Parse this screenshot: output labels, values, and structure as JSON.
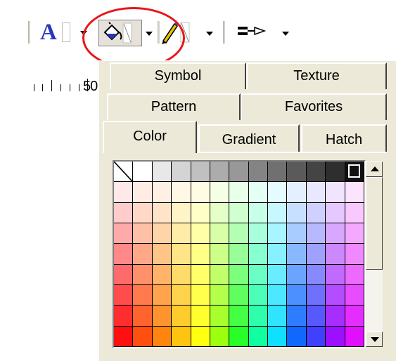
{
  "toolbar": {
    "font_icon_glyph": "A",
    "ruler_value": "50"
  },
  "tabs": {
    "row1": [
      {
        "label": "Symbol"
      },
      {
        "label": "Texture"
      }
    ],
    "row2": [
      {
        "label": "Pattern"
      },
      {
        "label": "Favorites"
      }
    ],
    "row3": [
      {
        "label": "Color"
      },
      {
        "label": "Gradient"
      },
      {
        "label": "Hatch"
      }
    ],
    "active": "Color"
  },
  "palette": {
    "rows": [
      [
        "none",
        "#ffffff",
        "#e8e8e8",
        "#d4d4d4",
        "#c0c0c0",
        "#acacac",
        "#989898",
        "#848484",
        "#707070",
        "#5a5a5a",
        "#444444",
        "#2e2e2e",
        "selected-black"
      ],
      [
        "#ffe8e8",
        "#ffece4",
        "#fff0e4",
        "#fff8e4",
        "#fffce4",
        "#f4ffe4",
        "#e8ffe8",
        "#e4fff4",
        "#e4fcff",
        "#e4f0ff",
        "#e8e8ff",
        "#f0e4ff",
        "#fce4ff"
      ],
      [
        "#ffcccc",
        "#ffd8c8",
        "#ffe4c8",
        "#fff4c8",
        "#ffffc8",
        "#e4ffc8",
        "#d0ffd0",
        "#c8ffe8",
        "#c8f8ff",
        "#c8e0ff",
        "#d0d0ff",
        "#e4c8ff",
        "#f8c8ff"
      ],
      [
        "#ffaaaa",
        "#ffc0a8",
        "#ffd4a8",
        "#ffeca8",
        "#ffffa8",
        "#d8ffa8",
        "#b4ffb4",
        "#a8ffdc",
        "#a8f4ff",
        "#a8ccff",
        "#b8b8ff",
        "#d8a8ff",
        "#f4a8ff"
      ],
      [
        "#ff8888",
        "#ffa888",
        "#ffc488",
        "#ffe488",
        "#ffff88",
        "#ccff88",
        "#98ff98",
        "#88ffd0",
        "#88f0ff",
        "#88b8ff",
        "#a0a0ff",
        "#cc88ff",
        "#f088ff"
      ],
      [
        "#ff6a6a",
        "#ff906a",
        "#ffb46a",
        "#ffdc6a",
        "#ffff6a",
        "#c0ff6a",
        "#7cff7c",
        "#6affc4",
        "#6aecff",
        "#6aa4ff",
        "#8888ff",
        "#c06aff",
        "#ec6aff"
      ],
      [
        "#ff4c4c",
        "#ff7a4c",
        "#ffa44c",
        "#ffd44c",
        "#ffff4c",
        "#b4ff4c",
        "#60ff60",
        "#4cffb8",
        "#4ce8ff",
        "#4c90ff",
        "#7070ff",
        "#b44cff",
        "#e84cff"
      ],
      [
        "#ff2e2e",
        "#ff642e",
        "#ff942e",
        "#ffcc2e",
        "#ffff2e",
        "#a8ff2e",
        "#44ff44",
        "#2effac",
        "#2ee4ff",
        "#2e7cff",
        "#5858ff",
        "#a82eff",
        "#e42eff"
      ],
      [
        "#ff1010",
        "#ff5010",
        "#ff8410",
        "#ffc410",
        "#ffff10",
        "#9cff10",
        "#28ff28",
        "#10ffa0",
        "#10e0ff",
        "#1068ff",
        "#4040ff",
        "#9c10ff",
        "#e010ff"
      ]
    ]
  },
  "colors": {
    "highlight_circle": "#e8161a",
    "panel_bg": "#ece9d8",
    "font_icon": "#2a36b8"
  }
}
